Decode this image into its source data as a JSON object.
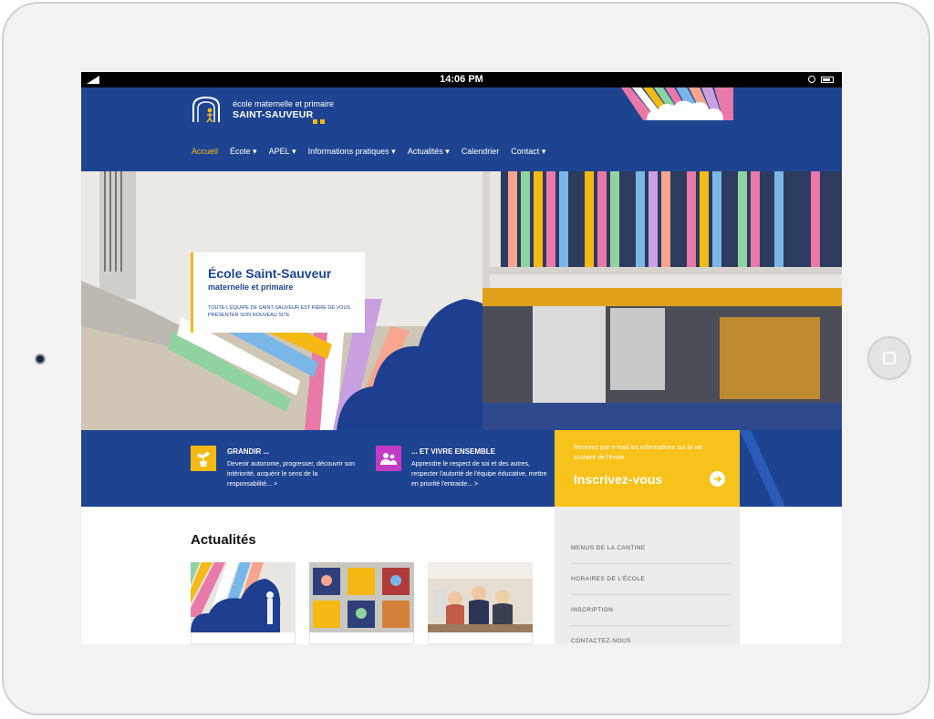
{
  "device": {
    "time": "14:06 PM"
  },
  "site": {
    "logo_line1": "école maternelle et primaire",
    "logo_line2": "SAINT-SAUVEUR"
  },
  "nav": [
    {
      "label": "Accueil",
      "dropdown": false,
      "active": true
    },
    {
      "label": "École",
      "dropdown": true
    },
    {
      "label": "APEL",
      "dropdown": true
    },
    {
      "label": "Informations pratiques",
      "dropdown": true
    },
    {
      "label": "Actualités",
      "dropdown": true
    },
    {
      "label": "Calendrier",
      "dropdown": false
    },
    {
      "label": "Contact",
      "dropdown": true
    }
  ],
  "hero": {
    "title": "École Saint-Sauveur",
    "subtitle": "maternelle et primaire",
    "description": "Toute l'équipe de Saint-Sauveur est fière de vous présenter son nouveau site"
  },
  "features": [
    {
      "title": "GRANDIR ...",
      "text": "Devenir autonome, progresser, découvrir son intériorité, acquérir le sens de la responsabilité... >",
      "icon": "plant-icon",
      "color": "#f5b914"
    },
    {
      "title": "... ET VIVRE ENSEMBLE",
      "text": "Apprendre le respect de soi et des autres, respecter l'autorité de l'équipe éducative, mettre en priorité l'entraide... >",
      "icon": "people-icon",
      "color": "#c33bc4"
    }
  ],
  "newsletter": {
    "text": "Recevez par e-mail les informations sur la vie scolaire de l'école",
    "cta": "Inscrivez-vous"
  },
  "news": {
    "title": "Actualités"
  },
  "sidebar": {
    "links": [
      "MENUS DE LA CANTINE",
      "HORAIRES DE L'ÉCOLE",
      "INSCRIPTION",
      "CONTACTEZ-NOUS"
    ]
  },
  "colors": {
    "primary": "#1e4491",
    "accent": "#f5b914",
    "purple": "#c33bc4",
    "sidebar": "#ececec"
  }
}
